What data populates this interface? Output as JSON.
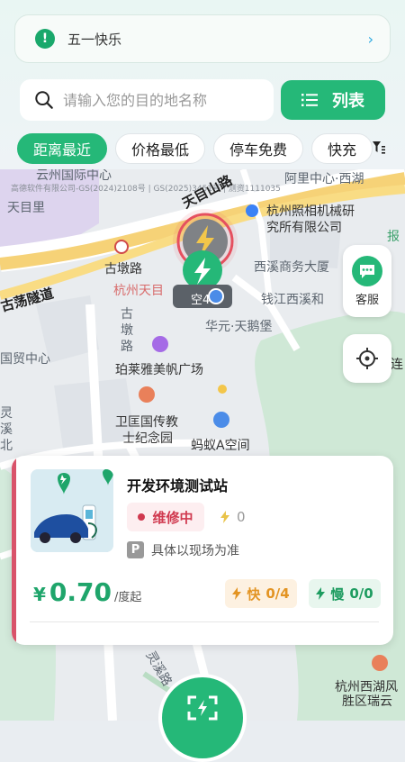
{
  "notice": {
    "text": "五一快乐",
    "arrow": "›"
  },
  "search": {
    "placeholder": "请输入您的目的地名称"
  },
  "list_button": {
    "label": "列表"
  },
  "filters": [
    "距离最近",
    "价格最低",
    "停车免费",
    "快充"
  ],
  "map": {
    "copyright": "高德软件有限公司-GS(2024)2108号 | GS(2025)3451号 | 测资1111035",
    "labels": {
      "yunzhou": "云州国际中心",
      "alibaba": "阿里中心·西湖",
      "tianmuli": "天目里",
      "camera": "杭州照相机械研",
      "camera2": "究所有限公司",
      "baozi": "报",
      "gudunlu": "古墩路",
      "xixi": "西溪商务大厦",
      "hangzhou_tian": "杭州天目",
      "guyang": "古荡隧道",
      "qiantang": "钱江西溪和",
      "huayuan": "华元·天鹅堡",
      "gudun2": "古墩路",
      "guomao": "国贸中心",
      "bolaiya": "珀莱雅美帆广场",
      "lianglu": "连",
      "weikuang": "卫匡国传教",
      "weikuang2": "士纪念园",
      "mayi": "蚂蚁A空间",
      "lingxi": "灵溪北",
      "lingxi2": "灵溪路",
      "xihu": "杭州西湖风",
      "xihu2": "胜区瑞云",
      "road_tianmushan": "天目山路",
      "marker_tag": "空4"
    }
  },
  "service": {
    "label": "客服"
  },
  "station": {
    "name": "开发环境测试站",
    "status": "维修中",
    "bolt_count": "0",
    "parking_note": "具体以现场为准",
    "parking_icon": "P",
    "price_symbol": "¥",
    "price": "0.70",
    "price_unit": "/度起",
    "fast_label": "快",
    "fast_count": "0/4",
    "slow_label": "慢",
    "slow_count": "0/0"
  },
  "colors": {
    "brand": "#25b878",
    "repair": "#d0394f",
    "fast": "#e39423"
  }
}
